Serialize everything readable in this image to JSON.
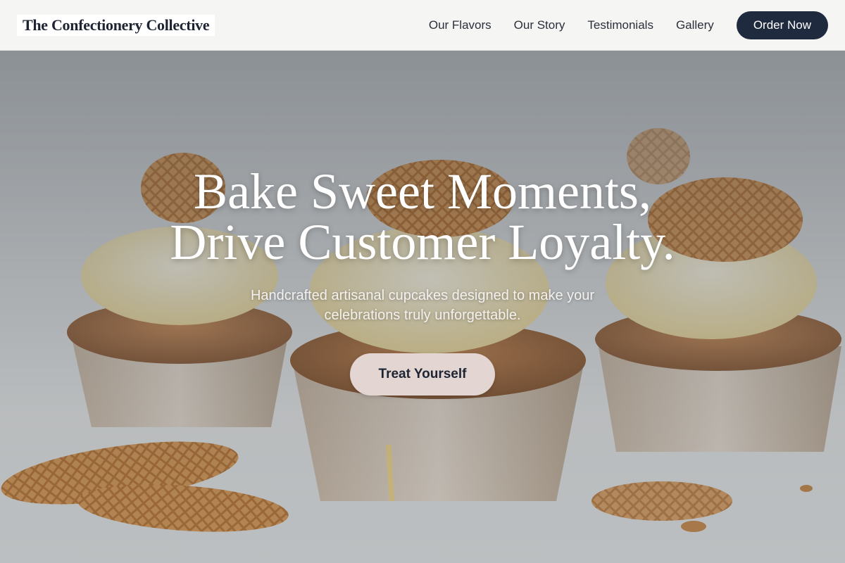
{
  "header": {
    "logo": "The Confectionery Collective",
    "nav": [
      {
        "label": "Our Flavors"
      },
      {
        "label": "Our Story"
      },
      {
        "label": "Testimonials"
      },
      {
        "label": "Gallery"
      }
    ],
    "cta_label": "Order Now"
  },
  "hero": {
    "headline_line1": "Bake Sweet Moments,",
    "headline_line2": "Drive Customer Loyalty.",
    "subheadline": "Handcrafted artisanal cupcakes designed to make your celebrations truly unforgettable.",
    "cta_label": "Treat Yourself",
    "background_image": "cupcakes-with-waffle-cookies-photo"
  },
  "colors": {
    "nav_bg": "#f5f5f4",
    "primary_dark": "#1f2a3f",
    "cta_light": "#e3d6d2",
    "text_dark": "#1f2433"
  }
}
